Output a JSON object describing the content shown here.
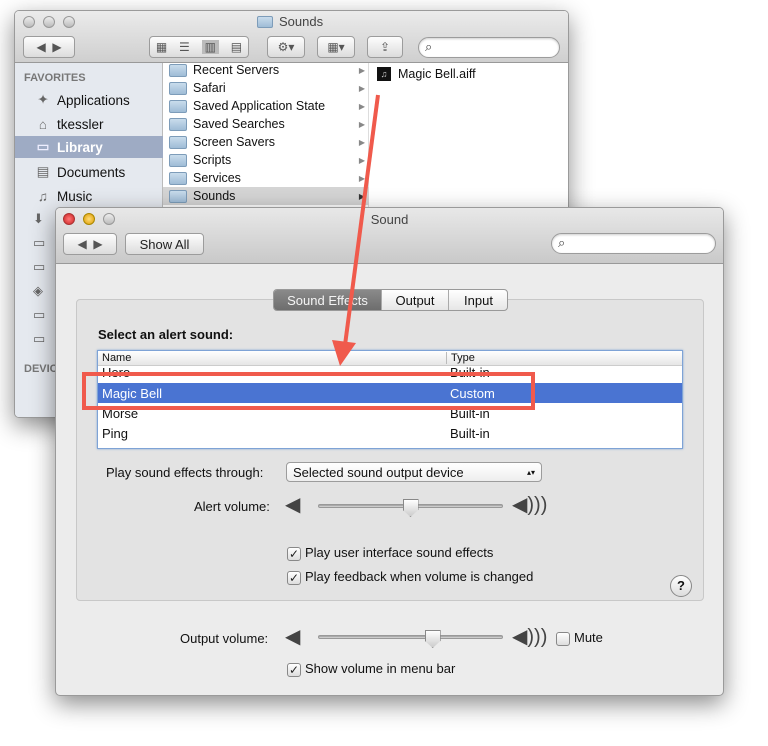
{
  "finder": {
    "title": "Sounds",
    "sidebar_header": "FAVORITES",
    "devices_header": "DEVICES",
    "sidebar": [
      {
        "label": "Applications",
        "icon": "applications-icon"
      },
      {
        "label": "tkessler",
        "icon": "home-icon"
      },
      {
        "label": "Library",
        "icon": "folder-icon",
        "selected": true
      },
      {
        "label": "Documents",
        "icon": "documents-icon"
      },
      {
        "label": "Music",
        "icon": "music-icon"
      }
    ],
    "column": [
      {
        "label": "Recent Servers"
      },
      {
        "label": "Safari"
      },
      {
        "label": "Saved Application State"
      },
      {
        "label": "Saved Searches"
      },
      {
        "label": "Screen Savers"
      },
      {
        "label": "Scripts"
      },
      {
        "label": "Services"
      },
      {
        "label": "Sounds",
        "selected": true
      }
    ],
    "file": "Magic Bell.aiff"
  },
  "sound": {
    "title": "Sound",
    "show_all": "Show All",
    "tabs": [
      {
        "label": "Sound Effects",
        "active": true
      },
      {
        "label": "Output"
      },
      {
        "label": "Input"
      }
    ],
    "select_label": "Select an alert sound:",
    "columns": {
      "name": "Name",
      "type": "Type"
    },
    "rows": [
      {
        "name": "Hero",
        "type": "Built-in"
      },
      {
        "name": "Magic Bell",
        "type": "Custom",
        "selected": true
      },
      {
        "name": "Morse",
        "type": "Built-in"
      },
      {
        "name": "Ping",
        "type": "Built-in"
      }
    ],
    "play_through_label": "Play sound effects through:",
    "play_through_value": "Selected sound output device",
    "alert_volume_label": "Alert volume:",
    "alert_volume": 0.5,
    "ui_sounds": "Play user interface sound effects",
    "ui_sounds_checked": true,
    "feedback": "Play feedback when volume is changed",
    "feedback_checked": true,
    "output_volume_label": "Output volume:",
    "output_volume": 0.62,
    "mute": "Mute",
    "mute_checked": false,
    "show_menu": "Show volume in menu bar",
    "show_menu_checked": true,
    "help": "?"
  },
  "colors": {
    "selection": "#4a74d2",
    "annotation": "#f05a4c",
    "sidebar_selected": "#9eabc4"
  }
}
